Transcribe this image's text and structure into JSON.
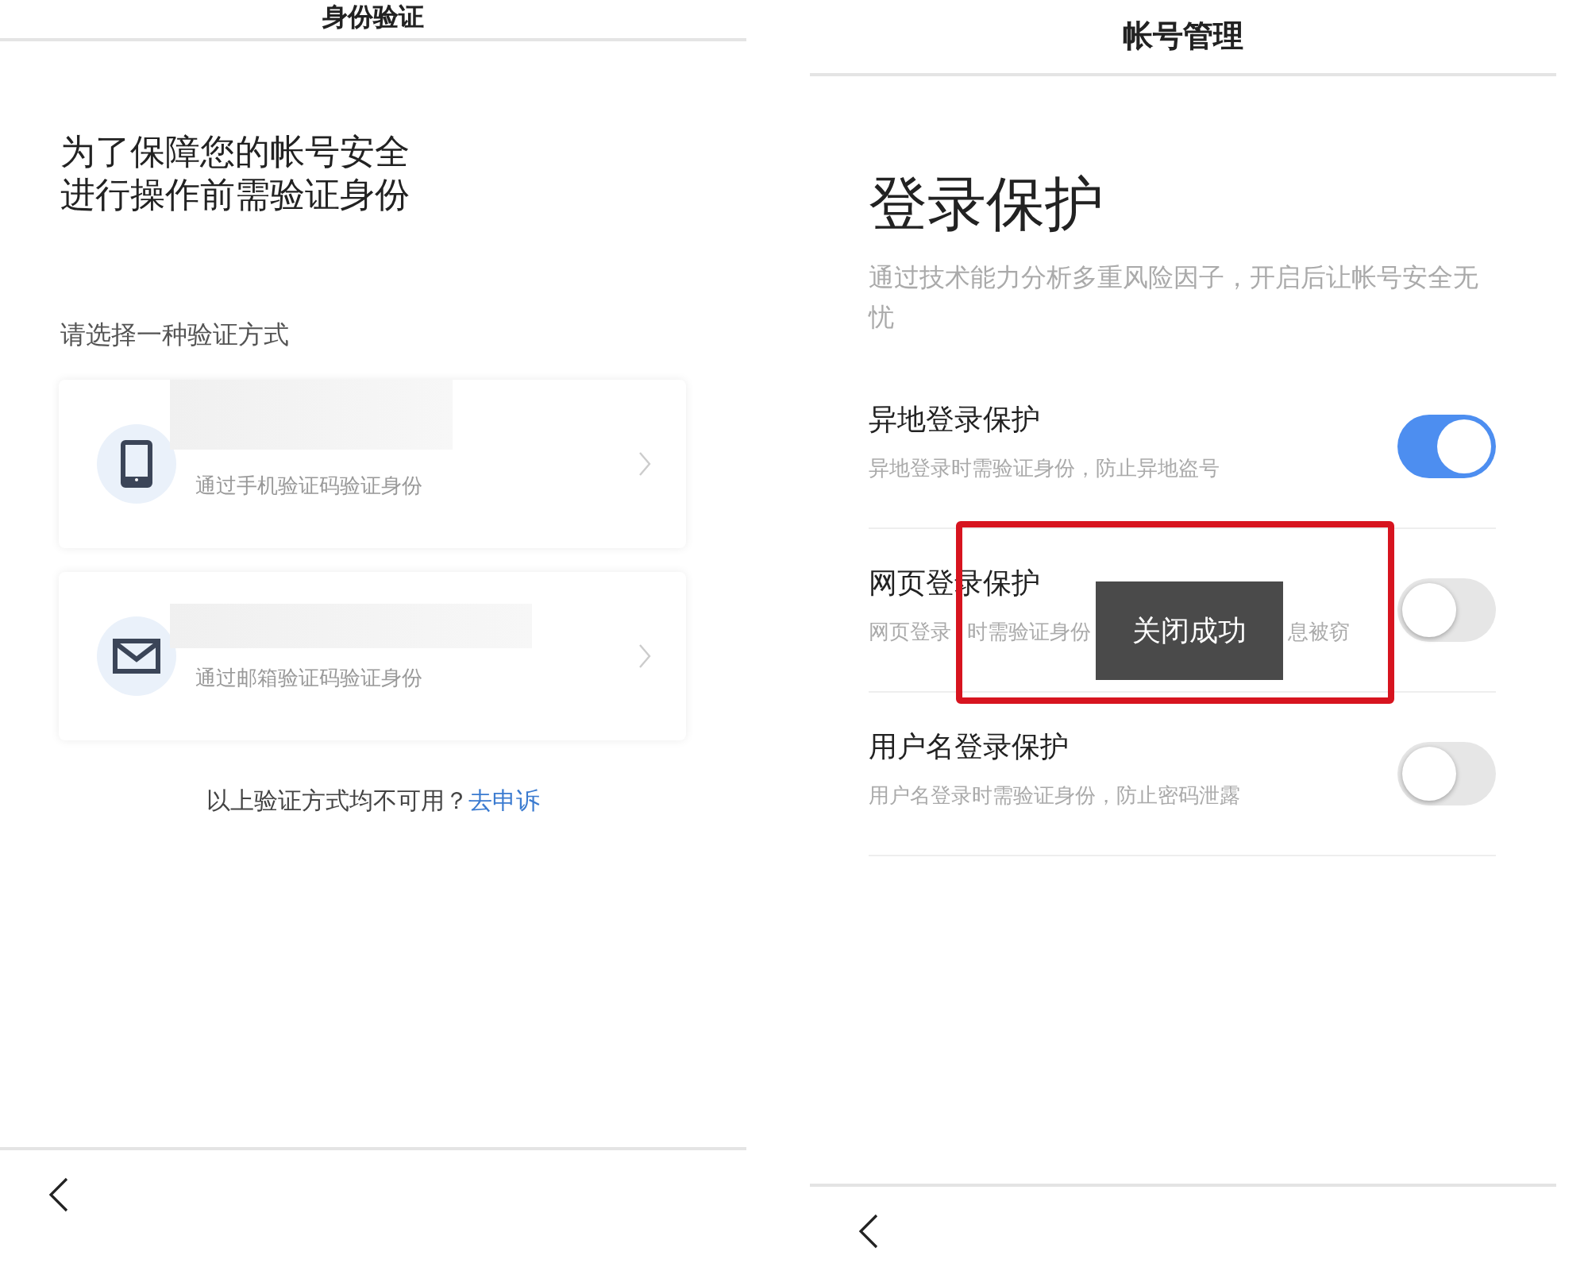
{
  "left_screen": {
    "header": {
      "title": "身份验证"
    },
    "headline": [
      "为了保障您的帐号安全",
      "进行操作前需验证身份"
    ],
    "prompt": "请选择一种验证方式",
    "methods": [
      {
        "kind": "phone",
        "description": "通过手机验证码验证身份"
      },
      {
        "kind": "email",
        "description": "通过邮箱验证码验证身份"
      }
    ],
    "footer": {
      "text": "以上验证方式均不可用？",
      "link": "去申诉"
    }
  },
  "right_screen": {
    "header": {
      "title": "帐号管理"
    },
    "title": "登录保护",
    "description": "通过技术能力分析多重风险因子，开启后让帐号安全无忧",
    "settings": [
      {
        "label": "异地登录保护",
        "description": [
          "异地登录时需验证身份，防止异地盗号"
        ],
        "on": true
      },
      {
        "label": "网页登录保护",
        "description": [
          "网页登录",
          "时需验证身份",
          "息被窃"
        ],
        "on": false
      },
      {
        "label": "用户名登录保护",
        "description": [
          "用户名登录时需验证身份，防止密码泄露"
        ],
        "on": false
      }
    ],
    "toast": "关闭成功"
  }
}
